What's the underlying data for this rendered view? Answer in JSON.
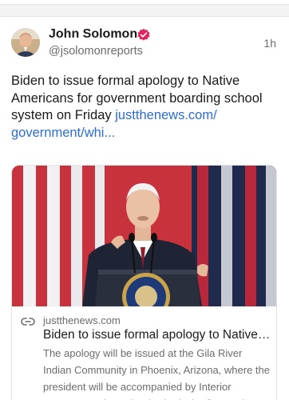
{
  "post": {
    "author_name": "John Solomon",
    "handle": "@jsolomonreports",
    "time": "1h",
    "text": "Biden to issue formal apology to Native Americans for government boarding school system on Friday ",
    "link_text": "justthenews.com/ government/whi...",
    "icons": {
      "verified": "verified-badge-icon",
      "link": "link-icon"
    },
    "colors": {
      "link": "#2b6cd7",
      "verified": "#e0245e"
    }
  },
  "embed": {
    "domain": "justthenews.com",
    "title": "Biden to issue formal apology to Native Americans for government boarding school system on Friday",
    "description": "The apology will be issued at the Gila River Indian Community in Phoenix, Arizona, where the president will be accompanied by Interior Secretary Deb Haaland, who is the first Native American to serve as a Cabinet secretary."
  }
}
